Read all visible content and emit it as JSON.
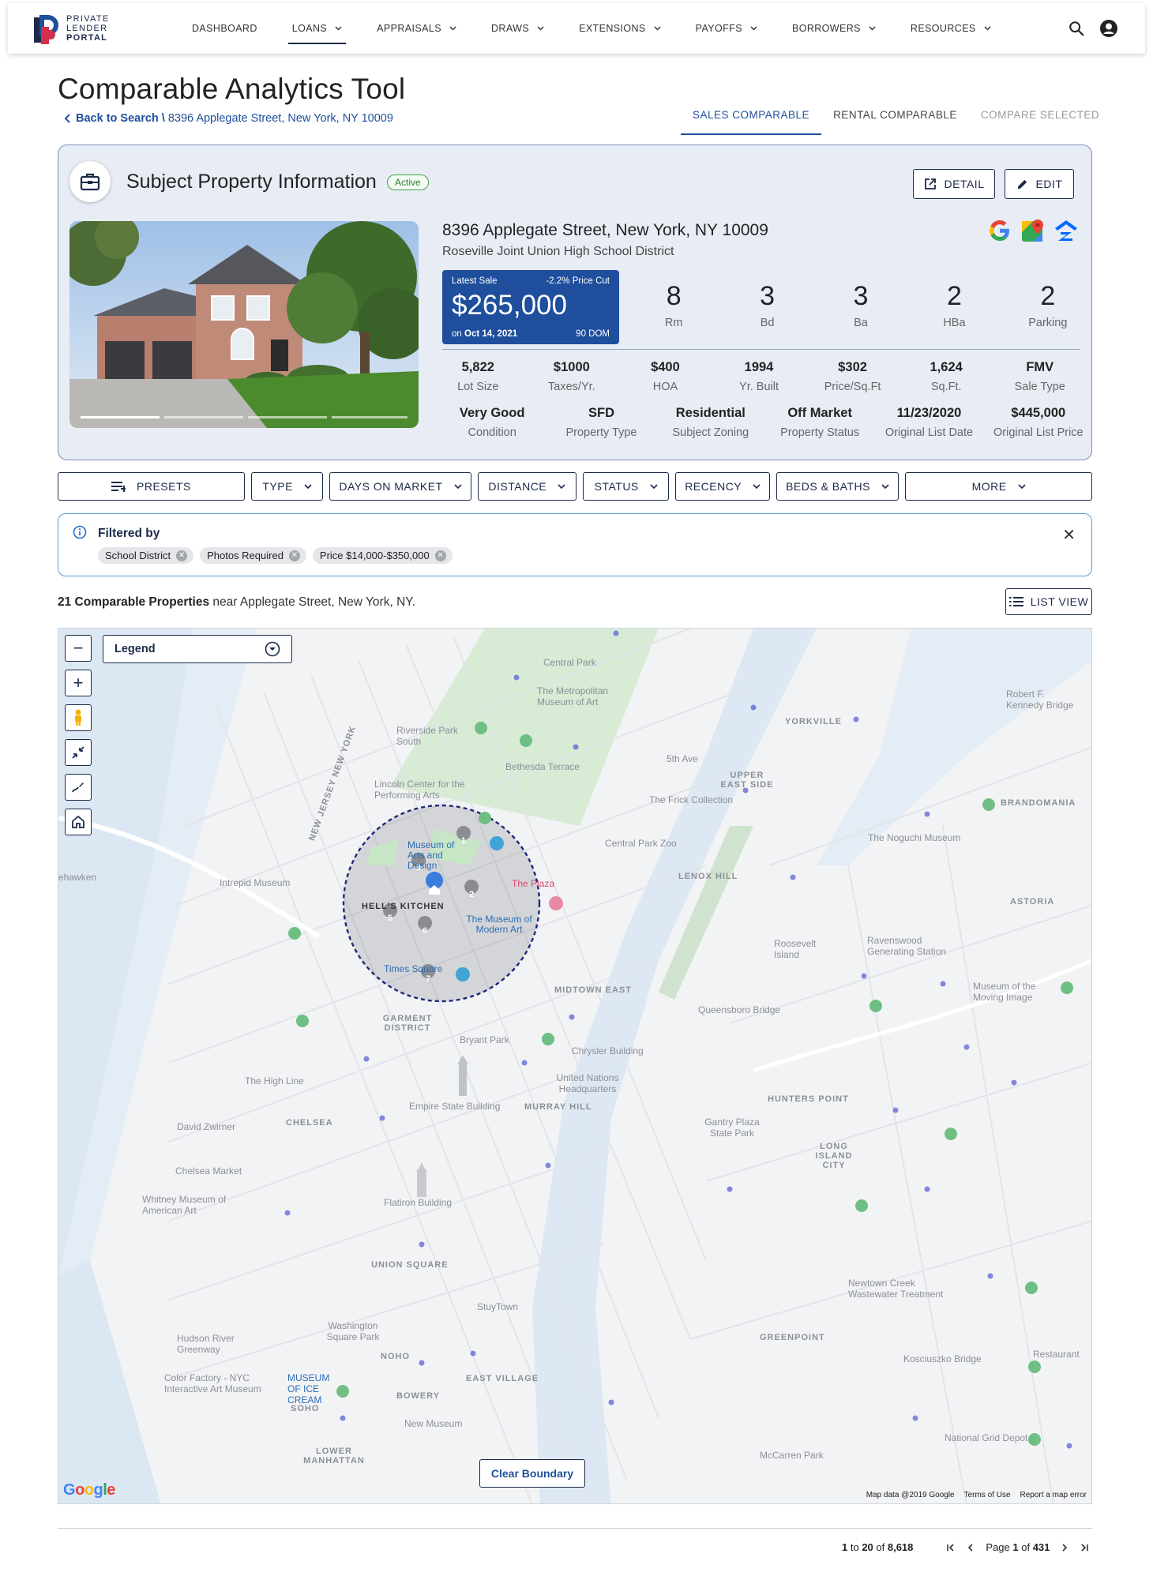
{
  "brand": {
    "line1": "PRIVATE",
    "line2": "LENDER",
    "line3": "PORTAL"
  },
  "nav": [
    {
      "label": "DASHBOARD",
      "chevron": false,
      "active": false
    },
    {
      "label": "LOANS",
      "chevron": true,
      "active": true
    },
    {
      "label": "APPRAISALS",
      "chevron": true,
      "active": false
    },
    {
      "label": "DRAWS",
      "chevron": true,
      "active": false
    },
    {
      "label": "EXTENSIONS",
      "chevron": true,
      "active": false
    },
    {
      "label": "PAYOFFS",
      "chevron": true,
      "active": false
    },
    {
      "label": "BORROWERS",
      "chevron": true,
      "active": false
    },
    {
      "label": "RESOURCES",
      "chevron": true,
      "active": false
    }
  ],
  "page": {
    "title": "Comparable Analytics Tool",
    "back_label": "Back to Search \\",
    "crumb_address": "8396 Applegate Street, New York, NY 10009"
  },
  "tabs": [
    "SALES COMPARABLE",
    "RENTAL COMPARABLE",
    "COMPARE SELECTED"
  ],
  "subject": {
    "title": "Subject Property Information",
    "status": "Active",
    "detail_label": "DETAIL",
    "edit_label": "EDIT",
    "address": "8396 Applegate Street, New York, NY 10009",
    "district": "Roseville Joint Union High School District",
    "sale": {
      "label": "Latest Sale",
      "price_cut": "-2.2% Price Cut",
      "price": "$265,000",
      "on_prefix": "on ",
      "date": "Oct 14, 2021",
      "dom": "90 DOM"
    },
    "big_stats": [
      {
        "value": "8",
        "label": "Rm"
      },
      {
        "value": "3",
        "label": "Bd"
      },
      {
        "value": "3",
        "label": "Ba"
      },
      {
        "value": "2",
        "label": "HBa"
      },
      {
        "value": "2",
        "label": "Parking"
      }
    ],
    "stats_row1": [
      {
        "value": "5,822",
        "label": "Lot Size"
      },
      {
        "value": "$1000",
        "label": "Taxes/Yr."
      },
      {
        "value": "$400",
        "label": "HOA"
      },
      {
        "value": "1994",
        "label": "Yr. Built"
      },
      {
        "value": "$302",
        "label": "Price/Sq.Ft"
      },
      {
        "value": "1,624",
        "label": "Sq.Ft."
      },
      {
        "value": "FMV",
        "label": "Sale Type"
      }
    ],
    "stats_row2": [
      {
        "value": "Very Good",
        "label": "Condition"
      },
      {
        "value": "SFD",
        "label": "Property Type"
      },
      {
        "value": "Residential",
        "label": "Subject Zoning"
      },
      {
        "value": "Off Market",
        "label": "Property Status"
      },
      {
        "value": "11/23/2020",
        "label": "Original List Date"
      },
      {
        "value": "$445,000",
        "label": "Original List Price"
      }
    ]
  },
  "filters": [
    {
      "label": "PRESETS",
      "icon": "sort-icon"
    },
    {
      "label": "TYPE",
      "chevron": true
    },
    {
      "label": "DAYS ON MARKET",
      "chevron": true
    },
    {
      "label": "DISTANCE",
      "chevron": true
    },
    {
      "label": "STATUS",
      "chevron": true
    },
    {
      "label": "RECENCY",
      "chevron": true
    },
    {
      "label": "BEDS & BATHS",
      "chevron": true
    },
    {
      "label": "MORE",
      "chevron": true
    }
  ],
  "filtered_by": {
    "title": "Filtered by",
    "chips": [
      "School District",
      "Photos Required",
      "Price $14,000-$350,000"
    ]
  },
  "results": {
    "count_bold": "21 Comparable Properties",
    "near_text": " near Applegate Street, New York, NY.",
    "list_view_label": "LIST VIEW"
  },
  "map": {
    "legend_label": "Legend",
    "clear_label": "Clear Boundary",
    "google": "Google",
    "footer": [
      "Map data @2019 Google",
      "Terms of Use",
      "Report a map error"
    ],
    "labels": [
      "Central Park",
      "The Metropolitan Museum of Art",
      "YORKVILLE",
      "Riverside Park South",
      "Bethesda Terrace",
      "5th Ave",
      "UPPER EAST SIDE",
      "Lincoln Center for the Performing Arts",
      "The Frick Collection",
      "The Noguchi Museum",
      "BRANDOMANIA",
      "Central Park Zoo",
      "LENOX HILL",
      "ASTORIA",
      "Intrepid Museum",
      "HELL'S KITCHEN",
      "Museum of Arts and Design",
      "The Museum of Modern Art",
      "Times Square",
      "MIDTOWN EAST",
      "Roosevelt Island",
      "Ravenswood Generating Station",
      "GARMENT DISTRICT",
      "Bryant Park",
      "Chrysler Building",
      "United Nations Headquarters",
      "The High Line",
      "Empire State Building",
      "MURRAY HILL",
      "HUNTERS POINT",
      "CHELSEA",
      "LONG ISLAND CITY",
      "Gantry Plaza State Park",
      "Flatiron Building",
      "UNION SQUARE",
      "StuyTown",
      "Washington Square Park",
      "NOHO",
      "EAST VILLAGE",
      "GREENPOINT",
      "SOHO",
      "BOWERY",
      "LOWER MANHATTAN",
      "McCarren Park",
      "Kosciuszko Bridge",
      "Hudson River Greenway",
      "NEW JERSEY NEW YORK",
      "Museum of the Moving Image",
      "Robert F. Kennedy Bridge",
      "ehawken",
      "Queensboro Bridge",
      "New Museum",
      "National Grid Depot",
      "Newtown Creek Wastewater Treatment",
      "Chelsea Market",
      "Whitney Museum of American Art",
      "David Zwirner",
      "MUSEUM OF ICE CREAM",
      "Color Factory - NYC Interactive Art Museum",
      "Restaurant",
      "The Plaza"
    ]
  },
  "pagination": {
    "range_from": "1",
    "range_to_word": " to ",
    "range_to": "20",
    "of_word": " of ",
    "total": "8,618",
    "page_word": "Page ",
    "page": "1",
    "page_of": " of ",
    "pages": "431"
  }
}
